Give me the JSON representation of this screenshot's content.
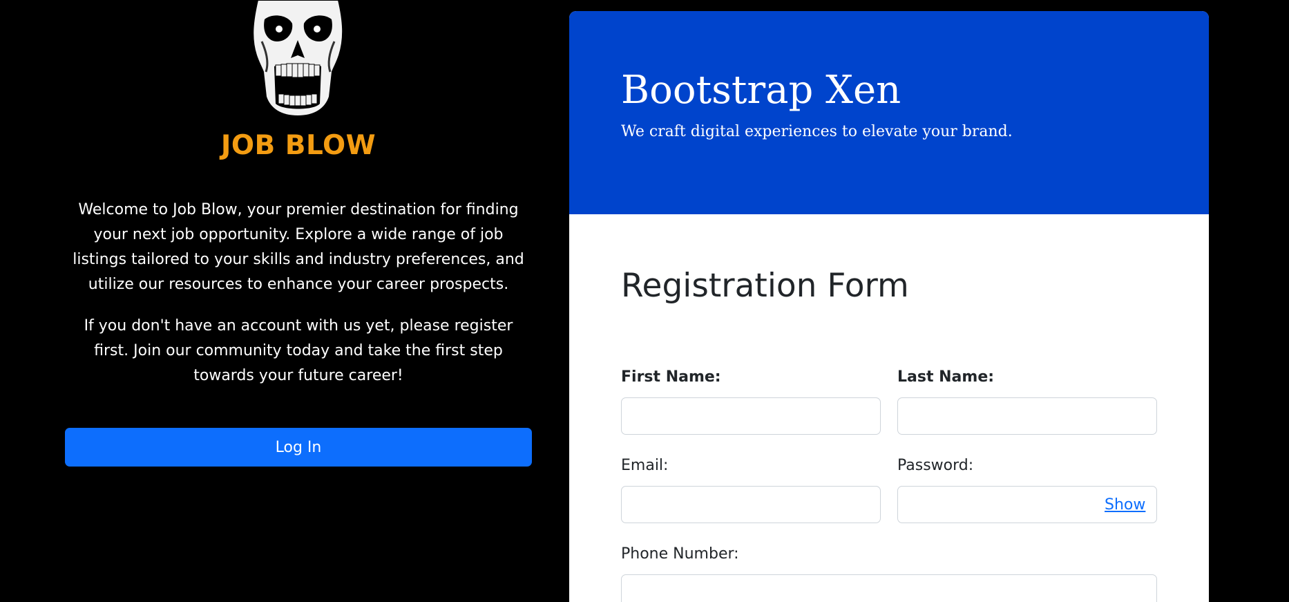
{
  "left_panel": {
    "brand": "JOB BLOW",
    "intro_text": "Welcome to Job Blow, your premier destination for finding your next job opportunity. Explore a wide range of job listings tailored to your skills and industry preferences, and utilize our resources to enhance your career prospects.",
    "register_text": "If you don't have an account with us yet, please register first. Join our community today and take the first step towards your future career!",
    "login_button": "Log In",
    "brand_color": "#f39c12",
    "button_color": "#0d6efd"
  },
  "card": {
    "header_title": "Bootstrap Xen",
    "header_subtitle": "We craft digital experiences to elevate your brand.",
    "header_color": "#0044cc",
    "form_title": "Registration Form",
    "fields": {
      "first_name": {
        "label": "First Name:",
        "value": ""
      },
      "last_name": {
        "label": "Last Name:",
        "value": ""
      },
      "email": {
        "label": "Email:",
        "value": ""
      },
      "password": {
        "label": "Password:",
        "value": "",
        "toggle": "Show"
      },
      "phone": {
        "label": "Phone Number:",
        "value": ""
      }
    }
  },
  "icons": {
    "logo": "skull-logo-icon"
  }
}
